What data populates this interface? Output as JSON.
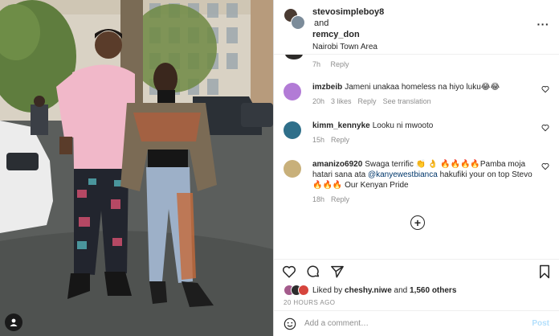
{
  "header": {
    "user1": "stevosimpleboy8",
    "connector": "and",
    "user2": "remcy_don",
    "location": "Nairobi Town Area",
    "more_label": "···"
  },
  "top_comment_meta": {
    "time": "7h",
    "reply": "Reply"
  },
  "comments": [
    {
      "user": "imzbeib",
      "text": "Jameni unakaa homeless na hiyo luku😂😂",
      "time": "20h",
      "likes": "3 likes",
      "reply": "Reply",
      "extra": "See translation",
      "avatar_color": "#b27bd6"
    },
    {
      "user": "kimm_kennyke",
      "text": "Looku ni mwooto",
      "time": "15h",
      "reply": "Reply",
      "avatar_color": "#2f6f8a"
    },
    {
      "user": "amanizo6920",
      "text_before": "Swaga terrific 👏 👌 🔥🔥🔥🔥Pamba moja hatari sana ata ",
      "mention": "@kanyewestbianca",
      "text_after": " hakufiki your on top Stevo🔥🔥🔥 Our Kenyan Pride",
      "time": "18h",
      "reply": "Reply",
      "avatar_color": "#c8b07a"
    }
  ],
  "load_more_label": "+",
  "likes": {
    "prefix": "Liked by",
    "user": "cheshy.niwe",
    "and": "and",
    "others": "1,560 others"
  },
  "timestamp": "20 HOURS AGO",
  "add_comment": {
    "placeholder": "Add a comment…",
    "post_label": "Post"
  },
  "colors": {
    "mention": "#00376b",
    "meta": "#8e8e8e",
    "post_disabled": "#b2dffc"
  },
  "icons": {
    "actions": [
      "heart-icon",
      "comment-icon",
      "share-icon",
      "bookmark-icon"
    ],
    "tags": "person-tag-icon",
    "emoji": "emoji-icon"
  }
}
